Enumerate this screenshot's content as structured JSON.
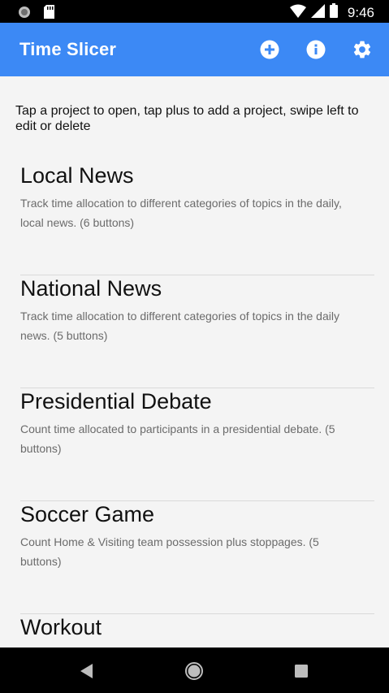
{
  "status_bar": {
    "time": "9:46",
    "icons": [
      "circle-notification-icon",
      "sd-card-icon",
      "wifi-icon",
      "cell-signal-icon",
      "battery-icon"
    ]
  },
  "app_bar": {
    "title": "Time Slicer",
    "background": "#3c89f5",
    "actions": [
      "add-circle-icon",
      "info-icon",
      "settings-gear-icon"
    ]
  },
  "instructions": "Tap a project to open, tap plus to add a project, swipe left to edit or delete",
  "projects": [
    {
      "name": "Local News",
      "description": "Track time allocation to different categories of topics in the daily, local news. (6 buttons)"
    },
    {
      "name": "National News",
      "description": "Track time allocation to different categories of topics in the daily news. (5 buttons)"
    },
    {
      "name": "Presidential Debate",
      "description": "Count time allocated to participants in a presidential debate. (5 buttons)"
    },
    {
      "name": "Soccer Game",
      "description": "Count Home & Visiting team possession plus stoppages. (5 buttons)"
    },
    {
      "name": "Workout",
      "description": ""
    }
  ],
  "nav_bar": {
    "buttons": [
      "back-triangle-icon",
      "home-circle-icon",
      "recents-square-icon"
    ]
  }
}
